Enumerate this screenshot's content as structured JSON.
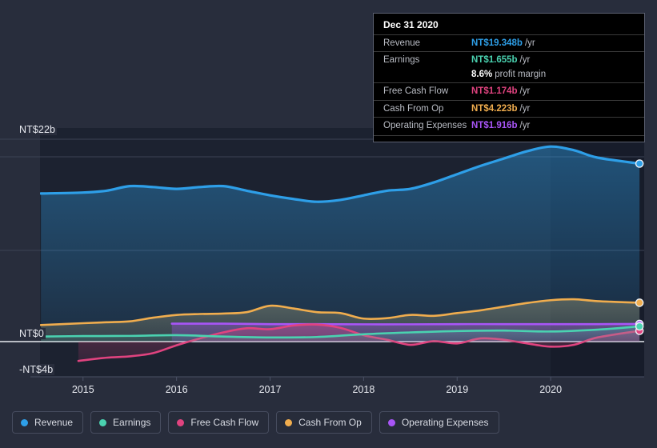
{
  "chart_data": {
    "type": "area",
    "title": "",
    "xlabel": "",
    "ylabel": "",
    "currency": "NT$",
    "ylim": [
      -4,
      22
    ],
    "y_ticks": [
      "NT$22b",
      "NT$0",
      "-NT$4b"
    ],
    "x_ticks": [
      "2015",
      "2016",
      "2017",
      "2018",
      "2019",
      "2020"
    ],
    "grid": true,
    "legend_position": "bottom-left",
    "series": [
      {
        "name": "Revenue",
        "color": "#2e9fe8",
        "end_value": "NT$19.348b",
        "points": [
          [
            2014.55,
            16.1
          ],
          [
            2015.0,
            16.2
          ],
          [
            2015.25,
            16.4
          ],
          [
            2015.5,
            16.9
          ],
          [
            2015.75,
            16.8
          ],
          [
            2016.0,
            16.6
          ],
          [
            2016.25,
            16.8
          ],
          [
            2016.5,
            16.9
          ],
          [
            2016.75,
            16.4
          ],
          [
            2017.0,
            15.9
          ],
          [
            2017.25,
            15.5
          ],
          [
            2017.5,
            15.2
          ],
          [
            2017.75,
            15.4
          ],
          [
            2018.0,
            15.9
          ],
          [
            2018.25,
            16.4
          ],
          [
            2018.5,
            16.6
          ],
          [
            2018.75,
            17.3
          ],
          [
            2019.0,
            18.2
          ],
          [
            2019.25,
            19.1
          ],
          [
            2019.5,
            19.9
          ],
          [
            2019.75,
            20.7
          ],
          [
            2020.0,
            21.2
          ],
          [
            2020.25,
            20.8
          ],
          [
            2020.5,
            20.0
          ],
          [
            2020.95,
            19.348
          ]
        ]
      },
      {
        "name": "Earnings",
        "color": "#4ad2b0",
        "end_value": "NT$1.655b",
        "profit_margin": "8.6%",
        "points": [
          [
            2014.55,
            0.55
          ],
          [
            2015.0,
            0.6
          ],
          [
            2015.5,
            0.62
          ],
          [
            2016.0,
            0.7
          ],
          [
            2016.5,
            0.55
          ],
          [
            2017.0,
            0.45
          ],
          [
            2017.5,
            0.5
          ],
          [
            2018.0,
            0.8
          ],
          [
            2018.5,
            1.0
          ],
          [
            2019.0,
            1.15
          ],
          [
            2019.5,
            1.2
          ],
          [
            2020.0,
            1.1
          ],
          [
            2020.5,
            1.3
          ],
          [
            2020.95,
            1.655
          ]
        ]
      },
      {
        "name": "Free Cash Flow",
        "color": "#e0437f",
        "end_value": "NT$1.174b",
        "points": [
          [
            2014.95,
            -2.1
          ],
          [
            2015.25,
            -1.75
          ],
          [
            2015.5,
            -1.6
          ],
          [
            2015.75,
            -1.25
          ],
          [
            2016.0,
            -0.4
          ],
          [
            2016.25,
            0.35
          ],
          [
            2016.5,
            1.0
          ],
          [
            2016.75,
            1.45
          ],
          [
            2017.0,
            1.35
          ],
          [
            2017.25,
            1.75
          ],
          [
            2017.5,
            1.85
          ],
          [
            2017.75,
            1.5
          ],
          [
            2018.0,
            0.7
          ],
          [
            2018.25,
            0.2
          ],
          [
            2018.5,
            -0.35
          ],
          [
            2018.75,
            0.05
          ],
          [
            2019.0,
            -0.2
          ],
          [
            2019.25,
            0.35
          ],
          [
            2019.5,
            0.2
          ],
          [
            2019.75,
            -0.2
          ],
          [
            2020.0,
            -0.55
          ],
          [
            2020.25,
            -0.35
          ],
          [
            2020.5,
            0.45
          ],
          [
            2020.95,
            1.174
          ]
        ]
      },
      {
        "name": "Cash From Op",
        "color": "#f0ad4e",
        "end_value": "NT$4.223b",
        "points": [
          [
            2014.55,
            1.8
          ],
          [
            2015.0,
            2.0
          ],
          [
            2015.25,
            2.1
          ],
          [
            2015.5,
            2.2
          ],
          [
            2015.75,
            2.6
          ],
          [
            2016.0,
            2.9
          ],
          [
            2016.25,
            3.0
          ],
          [
            2016.5,
            3.05
          ],
          [
            2016.75,
            3.2
          ],
          [
            2017.0,
            3.9
          ],
          [
            2017.25,
            3.6
          ],
          [
            2017.5,
            3.2
          ],
          [
            2017.75,
            3.1
          ],
          [
            2018.0,
            2.5
          ],
          [
            2018.25,
            2.55
          ],
          [
            2018.5,
            2.9
          ],
          [
            2018.75,
            2.8
          ],
          [
            2019.0,
            3.1
          ],
          [
            2019.25,
            3.4
          ],
          [
            2019.5,
            3.8
          ],
          [
            2019.75,
            4.2
          ],
          [
            2020.0,
            4.5
          ],
          [
            2020.25,
            4.6
          ],
          [
            2020.5,
            4.4
          ],
          [
            2020.95,
            4.223
          ]
        ]
      },
      {
        "name": "Operating Expenses",
        "color": "#a855f7",
        "end_value": "NT$1.916b",
        "points": [
          [
            2015.95,
            1.95
          ],
          [
            2016.5,
            1.95
          ],
          [
            2017.0,
            1.9
          ],
          [
            2017.5,
            1.9
          ],
          [
            2018.0,
            1.88
          ],
          [
            2018.5,
            1.88
          ],
          [
            2019.0,
            1.9
          ],
          [
            2019.5,
            1.9
          ],
          [
            2020.0,
            1.9
          ],
          [
            2020.5,
            1.9
          ],
          [
            2020.95,
            1.916
          ]
        ]
      }
    ]
  },
  "tooltip": {
    "date": "Dec 31 2020",
    "unit": "/yr",
    "rows": [
      {
        "key": "Revenue",
        "value": "NT$19.348b",
        "color": "#2e9fe8"
      },
      {
        "key": "Earnings",
        "value": "NT$1.655b",
        "color": "#4ad2b0"
      },
      {
        "key": "",
        "value": "8.6%",
        "suffix": "profit margin",
        "color": "#ffffff"
      },
      {
        "key": "Free Cash Flow",
        "value": "NT$1.174b",
        "color": "#e0437f"
      },
      {
        "key": "Cash From Op",
        "value": "NT$4.223b",
        "color": "#f0ad4e"
      },
      {
        "key": "Operating Expenses",
        "value": "NT$1.916b",
        "color": "#a855f7"
      }
    ]
  },
  "legend": {
    "items": [
      {
        "label": "Revenue",
        "color": "#2e9fe8"
      },
      {
        "label": "Earnings",
        "color": "#4ad2b0"
      },
      {
        "label": "Free Cash Flow",
        "color": "#e0437f"
      },
      {
        "label": "Cash From Op",
        "color": "#f0ad4e"
      },
      {
        "label": "Operating Expenses",
        "color": "#a855f7"
      }
    ]
  },
  "axes": {
    "y_top": "NT$22b",
    "y_zero": "NT$0",
    "y_bottom": "-NT$4b"
  }
}
